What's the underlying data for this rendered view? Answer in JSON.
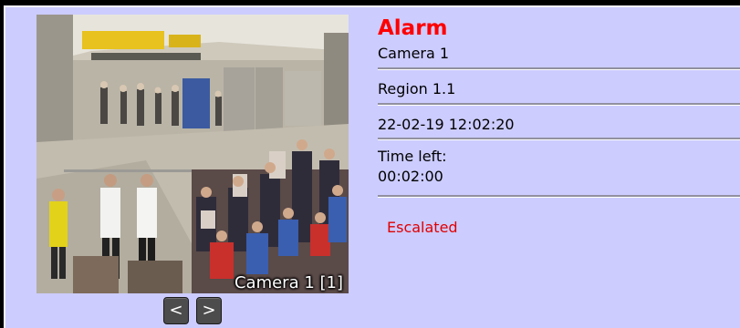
{
  "window": {
    "background_color": "#ccccff"
  },
  "video": {
    "caption": "Camera 1 [1]"
  },
  "navigation": {
    "prev_label": "<",
    "next_label": ">"
  },
  "alarm": {
    "title": "Alarm",
    "title_color": "#ff0000",
    "camera": "Camera 1",
    "region": "Region 1.1",
    "timestamp": "22-02-19 12:02:20",
    "time_left_label": "Time left:",
    "time_left_value": "00:02:00",
    "status": "Escalated",
    "status_color": "#e00000"
  }
}
